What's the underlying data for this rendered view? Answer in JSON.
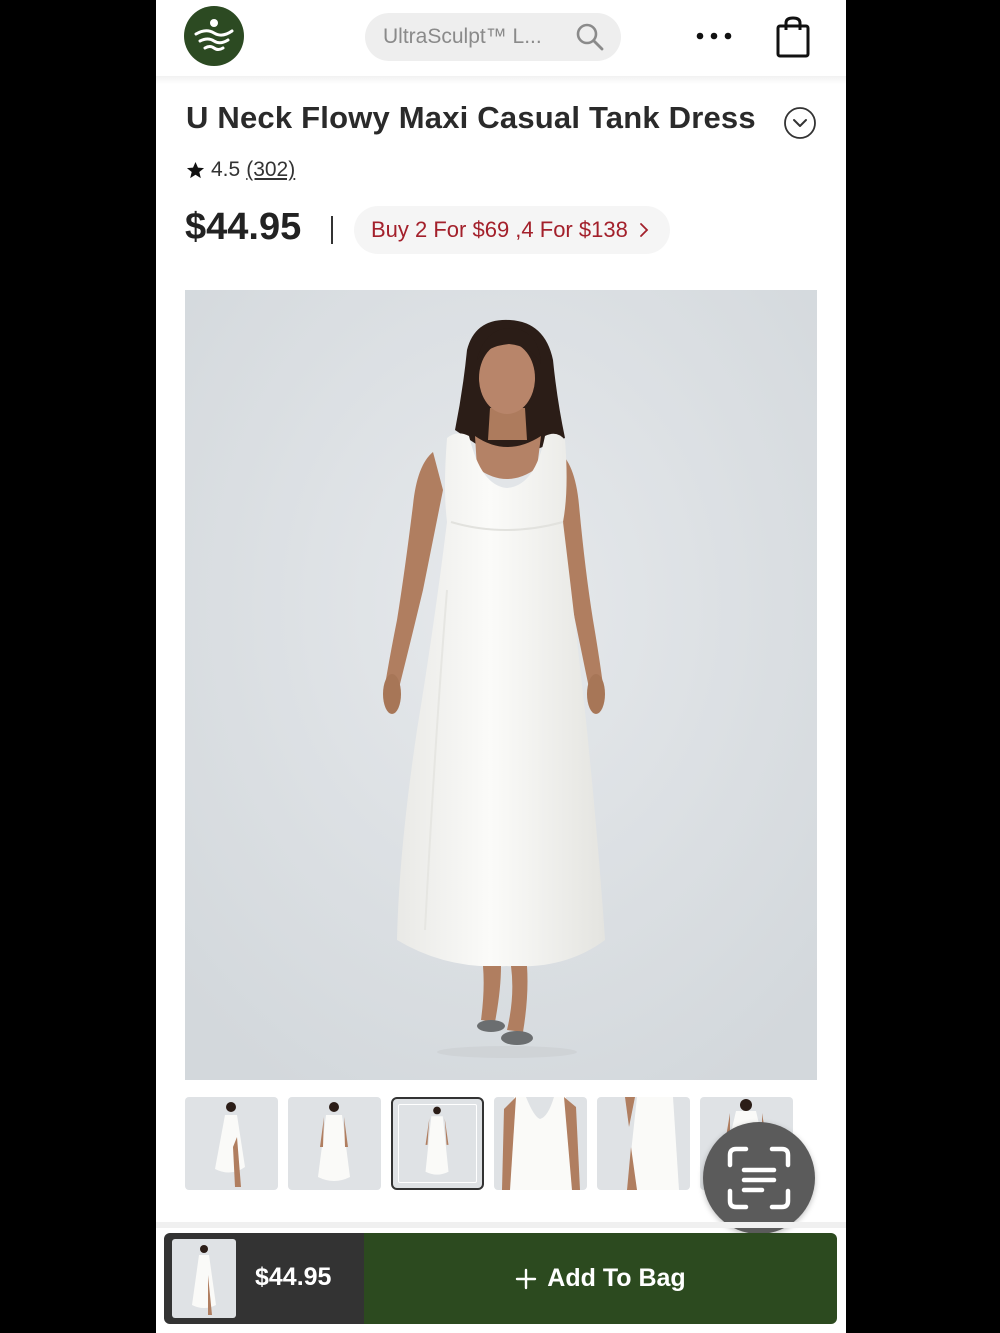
{
  "header": {
    "search_placeholder": "UltraSculpt™ L...",
    "icons": [
      "brand-logo-icon",
      "search-icon",
      "more-dots-icon",
      "shopping-bag-icon"
    ]
  },
  "product": {
    "title": "U Neck Flowy Maxi Casual Tank Dress",
    "rating": "4.5",
    "review_count": "(302)",
    "price": "$44.95",
    "promo": "Buy 2 For $69 ,4 For $138",
    "color": "White",
    "thumbnails_count": 6,
    "active_thumbnail": 3
  },
  "bottom_bar": {
    "price": "$44.95",
    "add_label": "Add To Bag"
  },
  "colors": {
    "brand_green": "#2c4a1f",
    "promo_red": "#a3202b",
    "image_bg": "#dde1e4"
  }
}
